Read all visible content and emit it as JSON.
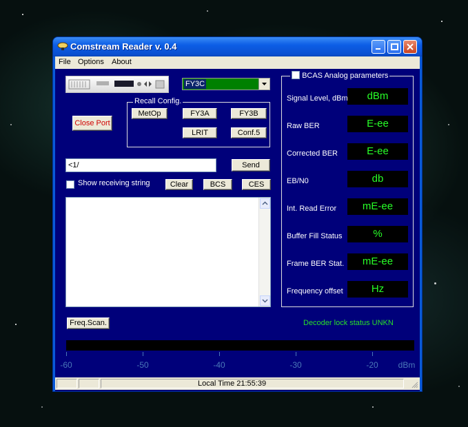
{
  "window": {
    "title": "Comstream Reader v. 0.4",
    "accent": "#0a5ad8",
    "client_bg": "#00007a"
  },
  "menu": {
    "items": [
      "File",
      "Options",
      "About"
    ]
  },
  "controls": {
    "satellite_select": "FY3C",
    "close_port_label": "Close Port",
    "recall": {
      "label": "Recall Config.",
      "buttons": [
        "MetOp",
        "FY3A",
        "FY3B",
        "LRIT",
        "Conf.5"
      ]
    },
    "command_input": "<1/",
    "send_label": "Send",
    "show_receiving_label": "Show receiving string",
    "show_receiving_checked": false,
    "clear_label": "Clear",
    "bcs_label": "BCS",
    "ces_label": "CES",
    "freq_scan_label": "Freq.Scan."
  },
  "bcas": {
    "label": "BCAS Analog parameters",
    "checked": false,
    "value_color": "#28ff28",
    "params": [
      {
        "label": "Signal Level, dBm",
        "value": "dBm"
      },
      {
        "label": "Raw BER",
        "value": "E-ee"
      },
      {
        "label": "Corrected BER",
        "value": "E-ee"
      },
      {
        "label": "EB/N0",
        "value": "db"
      },
      {
        "label": "Int. Read Error",
        "value": "mE-ee"
      },
      {
        "label": "Buffer Fill Status",
        "value": "%"
      },
      {
        "label": "Frame BER Stat.",
        "value": "mE-ee"
      },
      {
        "label": "Frequency offset",
        "value": "Hz"
      }
    ]
  },
  "decoder_lock": "Decoder lock status UNKN",
  "level_scale": {
    "labels": [
      "-60",
      "-50",
      "-40",
      "-30",
      "-20"
    ],
    "unit": "dBm"
  },
  "status": {
    "local_time": "Local Time  21:55:39"
  }
}
